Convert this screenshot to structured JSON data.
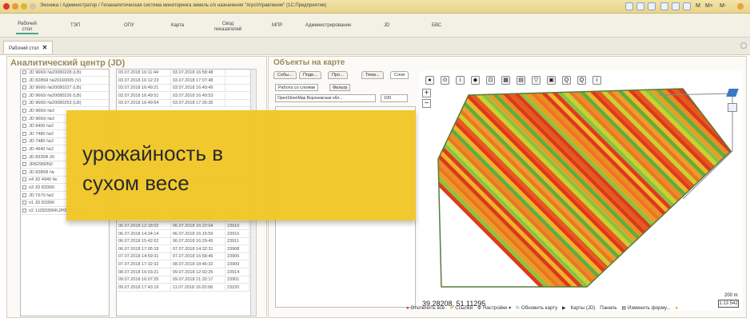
{
  "window": {
    "title": "Эконика / Администратор / Геоаналитическая система мониторинга земель с/х назначения \"АгроУправление\"  (1С:Предприятие)",
    "toolbar_right": [
      "M",
      "M+",
      "M-"
    ]
  },
  "menu": {
    "items": [
      "Рабочий стол",
      "ТЭП",
      "ОПУ",
      "Карта",
      "Свод показателей",
      "МПР",
      "Администрирование",
      "JD",
      "БВС"
    ]
  },
  "tabs": {
    "active_label": "Рабочий стол",
    "close": "✕"
  },
  "left_panel": {
    "title": "Аналитический центр (JD)",
    "machines": [
      "JD 9660i №20080228 (LB)",
      "JD 8285R №20160005 (V)",
      "JD 9660i №20080227 (LB)",
      "JD 9660i №20080226 (LB)",
      "JD 9660i №20080253 (LB)",
      "JD 9660i №2",
      "JD 9660i №2",
      "JD 8400 №2",
      "JD 7480 №2",
      "JD 7480 №2",
      "JD 4940 №2",
      "JD 8335R 20",
      "JR8295RN2",
      "JD 8285R №",
      "n4 JD 4940 №",
      "n3 JD 8335R",
      "JD T670 №2",
      "n1 JD 8335R",
      "n2 1JZ8335RKJP058218 T"
    ],
    "sessions": [
      [
        "03.07.2018 16:11:44",
        "03.07.2018 16:58:48",
        ""
      ],
      [
        "03.07.2018 16:12:23",
        "03.07.2018 17:07:48",
        ""
      ],
      [
        "03.07.2018 16:49:21",
        "03.07.2018 16:49:49",
        ""
      ],
      [
        "03.07.2018 16:49:51",
        "03.07.2018 16:49:53",
        ""
      ],
      [
        "03.07.2018 16:49:54",
        "03.07.2018 17:26:35",
        ""
      ],
      [
        "",
        "",
        ""
      ],
      [
        "",
        "",
        ""
      ],
      [
        "",
        "",
        ""
      ],
      [
        "",
        "",
        ""
      ],
      [
        "",
        "",
        ""
      ],
      [
        "",
        "",
        ""
      ],
      [
        "",
        "",
        ""
      ],
      [
        "",
        "",
        ""
      ],
      [
        "",
        "",
        ""
      ],
      [
        "",
        "",
        ""
      ],
      [
        "",
        "",
        ""
      ],
      [
        "",
        "",
        ""
      ],
      [
        "",
        "",
        ""
      ],
      [
        "04.07.2018 20:43:51",
        "04.07.2018 23:15:54",
        "23930"
      ],
      [
        "05.07.2018 16:59:25",
        "05.07.2018 18:49:45",
        "23933"
      ],
      [
        "06.07.2018 12:18:02",
        "06.07.2018 16:22:04",
        "23910"
      ],
      [
        "06.07.2018 14:34:14",
        "06.07.2018 16:15:59",
        "23915"
      ],
      [
        "06.07.2018 15:42:52",
        "06.07.2018 16:29:45",
        "23911"
      ],
      [
        "06.07.2018 17:05:18",
        "07.07.2018 14:32:31",
        "23908"
      ],
      [
        "07.07.2018 14:59:31",
        "07.07.2018 16:58:46",
        "23905"
      ],
      [
        "07.07.2018 17:32:32",
        "08.07.2018 18:46:32",
        "23909"
      ],
      [
        "08.07.2018 16:03:21",
        "09.07.2018 12:02:25",
        "23914"
      ],
      [
        "09.07.2018 16:07:25",
        "09.07.2018 21:32:17",
        "23901"
      ],
      [
        "09.07.2018 17:43:19",
        "11.07.2018 16:20:08",
        "23220"
      ]
    ]
  },
  "right_panel": {
    "title": "Объекты на карте",
    "tabs": [
      "Собы...",
      "Подв...",
      "Про...",
      "Тема...",
      "Слои"
    ],
    "subtabs": [
      "Работа со слоями",
      "Фильтр"
    ],
    "layer_select": "OpenStreetMap Воронежская обл...",
    "opacity": "100",
    "map_tools": [
      "●",
      "⊙",
      "i",
      "◆",
      "⊡",
      "▦",
      "▤",
      "▽",
      "▣",
      "Q",
      "Q",
      "i"
    ],
    "zoom_in": "+",
    "zoom_out": "−",
    "coords": "39.28208, 51.11295",
    "scale_top": "200 m",
    "scale_bottom": "1:13 542"
  },
  "bottom_bar": {
    "items": [
      "Отключить все",
      "Ссылки",
      "Настройки",
      "Обновить карту",
      "Карты (JD)",
      "Панель",
      "Изменить форму..."
    ]
  },
  "overlay": {
    "line1": "урожайность в",
    "line2": "сухом весе"
  }
}
